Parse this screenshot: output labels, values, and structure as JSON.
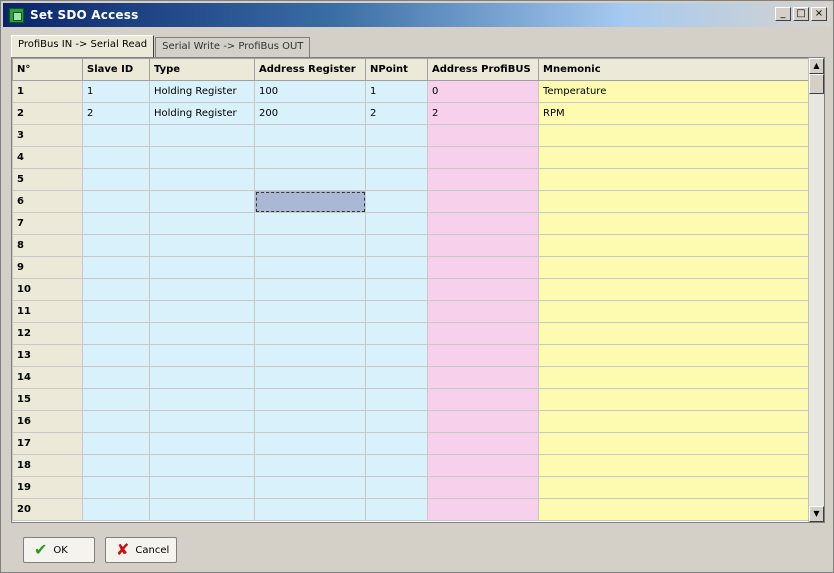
{
  "window": {
    "title": "Set SDO Access",
    "buttons": [
      "_",
      "□",
      "×"
    ]
  },
  "tabs": [
    {
      "label": "ProfiBus IN -> Serial Read",
      "active": true
    },
    {
      "label": "Serial Write -> ProfiBus OUT",
      "active": false
    }
  ],
  "table": {
    "columns": [
      "N°",
      "Slave ID",
      "Type",
      "Address Register",
      "NPoint",
      "Address ProfiBUS",
      "Mnemonic"
    ],
    "rows": [
      {
        "n": "1",
        "slave_id": "1",
        "type": "Holding Register",
        "address_register": "100",
        "npoint": "1",
        "address_profibus": "0",
        "mnemonic": "Temperature"
      },
      {
        "n": "2",
        "slave_id": "2",
        "type": "Holding Register",
        "address_register": "200",
        "npoint": "2",
        "address_profibus": "2",
        "mnemonic": "RPM"
      },
      {
        "n": "3",
        "slave_id": "",
        "type": "",
        "address_register": "",
        "npoint": "",
        "address_profibus": "",
        "mnemonic": ""
      },
      {
        "n": "4",
        "slave_id": "",
        "type": "",
        "address_register": "",
        "npoint": "",
        "address_profibus": "",
        "mnemonic": ""
      },
      {
        "n": "5",
        "slave_id": "",
        "type": "",
        "address_register": "",
        "npoint": "",
        "address_profibus": "",
        "mnemonic": ""
      },
      {
        "n": "6",
        "slave_id": "",
        "type": "",
        "address_register": "",
        "npoint": "",
        "address_profibus": "",
        "mnemonic": ""
      },
      {
        "n": "7",
        "slave_id": "",
        "type": "",
        "address_register": "",
        "npoint": "",
        "address_profibus": "",
        "mnemonic": ""
      },
      {
        "n": "8",
        "slave_id": "",
        "type": "",
        "address_register": "",
        "npoint": "",
        "address_profibus": "",
        "mnemonic": ""
      },
      {
        "n": "9",
        "slave_id": "",
        "type": "",
        "address_register": "",
        "npoint": "",
        "address_profibus": "",
        "mnemonic": ""
      },
      {
        "n": "10",
        "slave_id": "",
        "type": "",
        "address_register": "",
        "npoint": "",
        "address_profibus": "",
        "mnemonic": ""
      },
      {
        "n": "11",
        "slave_id": "",
        "type": "",
        "address_register": "",
        "npoint": "",
        "address_profibus": "",
        "mnemonic": ""
      },
      {
        "n": "12",
        "slave_id": "",
        "type": "",
        "address_register": "",
        "npoint": "",
        "address_profibus": "",
        "mnemonic": ""
      },
      {
        "n": "13",
        "slave_id": "",
        "type": "",
        "address_register": "",
        "npoint": "",
        "address_profibus": "",
        "mnemonic": ""
      },
      {
        "n": "14",
        "slave_id": "",
        "type": "",
        "address_register": "",
        "npoint": "",
        "address_profibus": "",
        "mnemonic": ""
      },
      {
        "n": "15",
        "slave_id": "",
        "type": "",
        "address_register": "",
        "npoint": "",
        "address_profibus": "",
        "mnemonic": ""
      },
      {
        "n": "16",
        "slave_id": "",
        "type": "",
        "address_register": "",
        "npoint": "",
        "address_profibus": "",
        "mnemonic": ""
      },
      {
        "n": "17",
        "slave_id": "",
        "type": "",
        "address_register": "",
        "npoint": "",
        "address_profibus": "",
        "mnemonic": ""
      },
      {
        "n": "18",
        "slave_id": "",
        "type": "",
        "address_register": "",
        "npoint": "",
        "address_profibus": "",
        "mnemonic": ""
      },
      {
        "n": "19",
        "slave_id": "",
        "type": "",
        "address_register": "",
        "npoint": "",
        "address_profibus": "",
        "mnemonic": ""
      },
      {
        "n": "20",
        "slave_id": "",
        "type": "",
        "address_register": "",
        "npoint": "",
        "address_profibus": "",
        "mnemonic": ""
      }
    ],
    "selected_cell": {
      "row": 6,
      "column": "address_register"
    }
  },
  "buttons": {
    "ok_label": "OK",
    "cancel_label": "Cancel"
  },
  "colors": {
    "blue_columns": "#d9f1fb",
    "pink_column": "#f7d1ec",
    "yellow_column": "#fdfbb0",
    "selected_cell": "#aab8d6"
  }
}
